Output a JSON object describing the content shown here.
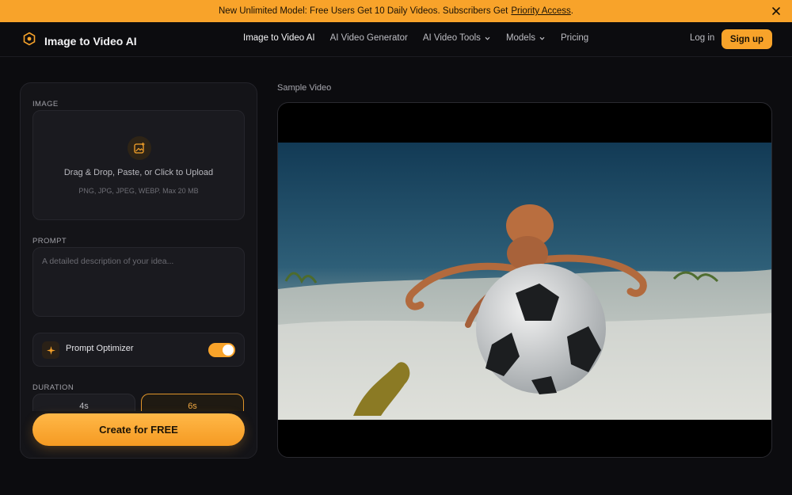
{
  "banner": {
    "text": "New Unlimited Model: Free Users Get 10 Daily Videos. Subscribers Get",
    "link": "Priority Access",
    "suffix": "."
  },
  "header": {
    "brand": "Image to Video AI",
    "nav": [
      {
        "label": "Image to Video AI",
        "dropdown": false,
        "active": true
      },
      {
        "label": "AI Video Generator",
        "dropdown": false
      },
      {
        "label": "AI Video Tools",
        "dropdown": true
      },
      {
        "label": "Models",
        "dropdown": true
      },
      {
        "label": "Pricing",
        "dropdown": false
      }
    ],
    "login": "Log in",
    "signup": "Sign up"
  },
  "form": {
    "image_label": "IMAGE",
    "upload_title": "Drag & Drop, Paste, or Click to Upload",
    "upload_sub": "PNG, JPG, JPEG, WEBP. Max 20 MB",
    "prompt_label": "PROMPT",
    "prompt_placeholder": "A detailed description of your idea...",
    "prompt_value": "",
    "optimizer_label": "Prompt Optimizer",
    "optimizer_on": true,
    "duration_label": "DURATION",
    "durations": [
      {
        "label": "4s",
        "selected": false
      },
      {
        "label": "6s",
        "selected": true
      }
    ],
    "create_button": "Create for FREE"
  },
  "preview": {
    "label": "Sample Video"
  },
  "colors": {
    "accent": "#f8a32a",
    "background": "#0c0c0f",
    "panel": "#141418"
  },
  "icons": [
    "close-icon",
    "logo-icon",
    "chevron-down-icon",
    "image-upload-icon",
    "sparkle-icon"
  ]
}
